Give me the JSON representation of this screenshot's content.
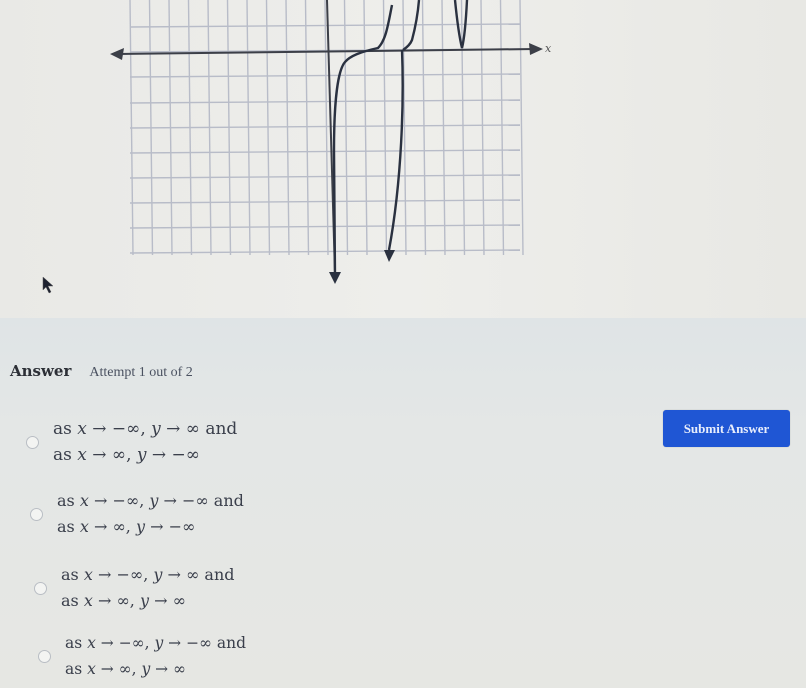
{
  "graph": {
    "x_axis_label": "x",
    "description": "Polynomial curve on grid; left arm descends to -infinity near the y-axis, crosses x-axis, rises, touches x-axis again, and rises off the top",
    "y_axis_direction_arrow": "down",
    "curve_end_arrow": "down"
  },
  "answer": {
    "title": "Answer",
    "attempt": "Attempt 1 out of 2",
    "submit_label": "Submit Answer",
    "options": [
      {
        "line1": [
          "as ",
          "x",
          " → −∞, ",
          "y",
          " → ∞ and"
        ],
        "line2": [
          "as ",
          "x",
          " → ∞, ",
          "y",
          " → −∞"
        ]
      },
      {
        "line1": [
          "as ",
          "x",
          " → −∞, ",
          "y",
          " → −∞ and"
        ],
        "line2": [
          "as ",
          "x",
          " → ∞, ",
          "y",
          " → −∞"
        ]
      },
      {
        "line1": [
          "as ",
          "x",
          " → −∞, ",
          "y",
          " → ∞ and"
        ],
        "line2": [
          "as ",
          "x",
          " → ∞, ",
          "y",
          " → ∞"
        ]
      },
      {
        "line1": [
          "as ",
          "x",
          " → −∞, ",
          "y",
          " → −∞ and"
        ],
        "line2": [
          "as ",
          "x",
          " → ∞, ",
          "y",
          " → ∞"
        ]
      }
    ]
  },
  "colors": {
    "submit_bg": "#1f56d4",
    "grid": "#b8bcc8",
    "axis": "#3c3f48",
    "curve": "#2a3140"
  }
}
